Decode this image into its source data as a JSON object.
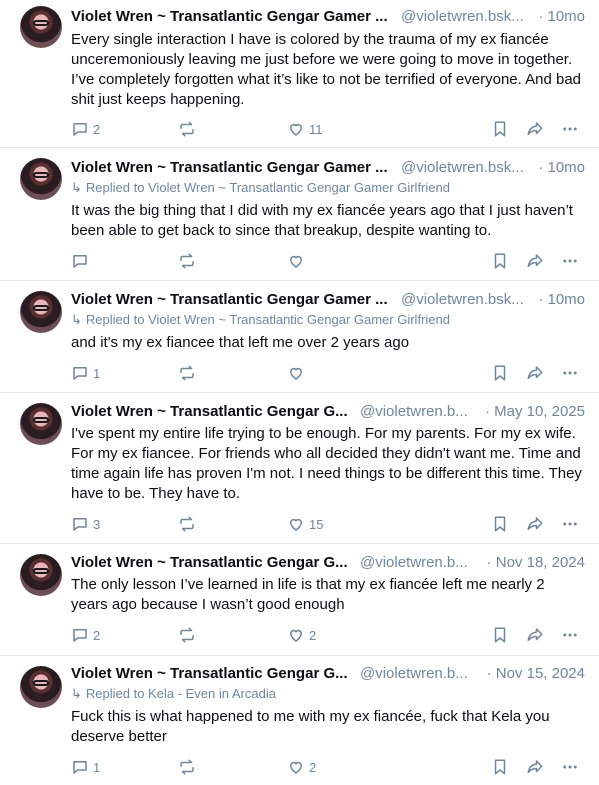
{
  "posts": [
    {
      "author": "Violet Wren ~ Transatlantic Gengar Gamer ...",
      "handle": "@violetwren.bsk...",
      "time": "· 10mo",
      "reply_to": "",
      "text": "Every single interaction I have is colored by the trauma of my ex fiancée unceremoniously leaving me just before we were going to move in together. I’ve completely forgotten what it’s like to not be terrified of everyone. And bad shit just keeps happening.",
      "replies": "2",
      "reposts": "",
      "likes": "11"
    },
    {
      "author": "Violet Wren ~ Transatlantic Gengar Gamer ...",
      "handle": "@violetwren.bsk...",
      "time": "· 10mo",
      "reply_to": "Replied to Violet Wren ~ Transatlantic Gengar Gamer Girlfriend",
      "text": "It was the big thing that I did with my ex fiancée years ago that I just haven’t been able to get back to since that breakup, despite wanting to.",
      "replies": "",
      "reposts": "",
      "likes": ""
    },
    {
      "author": "Violet Wren ~ Transatlantic Gengar Gamer ...",
      "handle": "@violetwren.bsk...",
      "time": "· 10mo",
      "reply_to": "Replied to Violet Wren ~ Transatlantic Gengar Gamer Girlfriend",
      "text": "and it's my ex fiancee that left me over 2 years ago",
      "replies": "1",
      "reposts": "",
      "likes": ""
    },
    {
      "author": "Violet Wren ~ Transatlantic Gengar G...",
      "handle": "@violetwren.b...",
      "time": "· May 10, 2025",
      "reply_to": "",
      "text": "I've spent my entire life trying to be enough. For my parents. For my ex wife. For my ex fiancee. For friends who all decided they didn't want me. Time and time again life has proven I'm not. I need things to be different this time. They have to be. They have to.",
      "replies": "3",
      "reposts": "",
      "likes": "15"
    },
    {
      "author": "Violet Wren ~ Transatlantic Gengar G...",
      "handle": "@violetwren.b...",
      "time": "· Nov 18, 2024",
      "reply_to": "",
      "text": "The only lesson I’ve learned in life is that my ex fiancée left me nearly 2 years ago because I wasn’t good enough",
      "replies": "2",
      "reposts": "",
      "likes": "2"
    },
    {
      "author": "Violet Wren ~ Transatlantic Gengar G...",
      "handle": "@violetwren.b...",
      "time": "· Nov 15, 2024",
      "reply_to": "Replied to Kela - Even in Arcadia",
      "text": "Fuck this is what happened to me with my ex fiancée, fuck that Kela you deserve better",
      "replies": "1",
      "reposts": "",
      "likes": "2"
    }
  ],
  "icons": {
    "reply": "reply-icon",
    "repost": "repost-icon",
    "like": "heart-icon",
    "bookmark": "bookmark-icon",
    "share": "share-icon",
    "more": "more-icon"
  },
  "colors": {
    "muted": "#6f869f",
    "text": "#0b0f14",
    "divider": "#e2e7ec"
  }
}
